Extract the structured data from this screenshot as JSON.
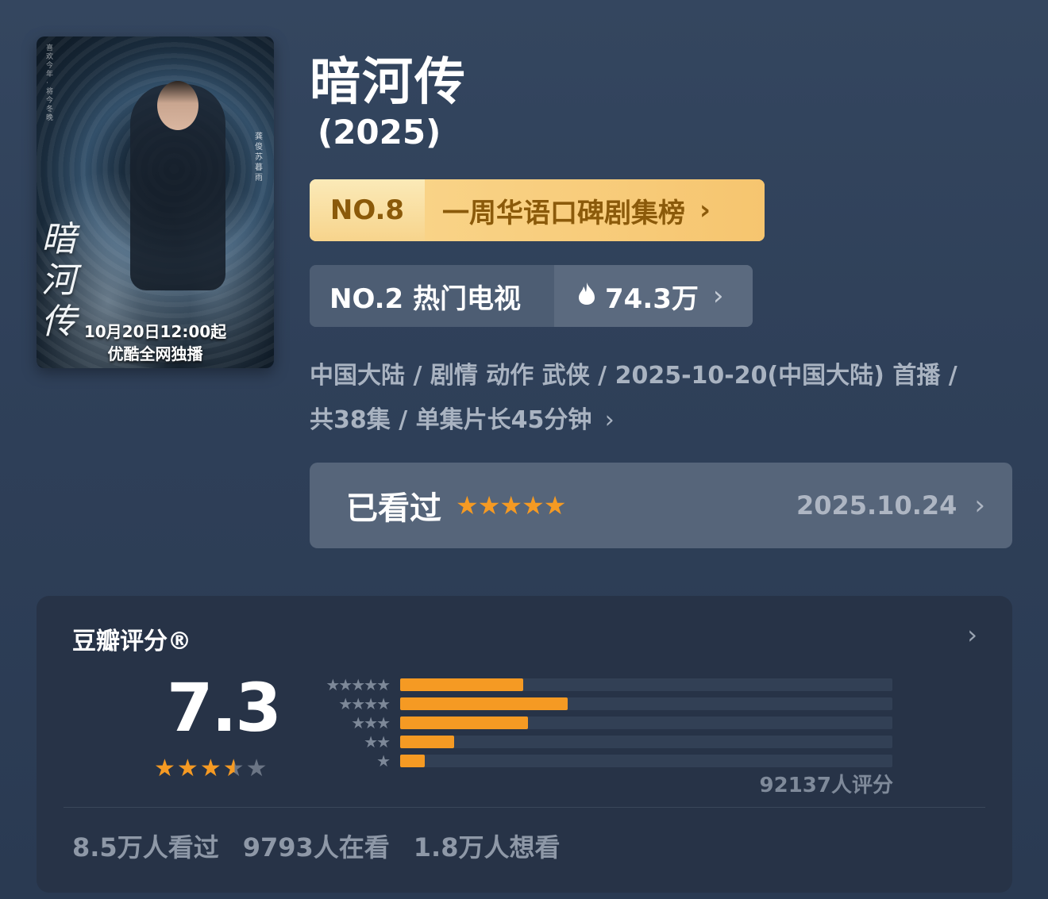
{
  "poster": {
    "calligraphy": "暗河传",
    "caption_line1": "10月20日12:00起",
    "caption_line2": "优酷全网独播",
    "side_text_left": "喜欢今年·将今冬晚",
    "side_text_right": "龚俊苏暮雨"
  },
  "title": "暗河传",
  "year": "(2025)",
  "rank_weekly": {
    "no": "NO.8",
    "label": "一周华语口碑剧集榜",
    "chevron": "›"
  },
  "rank_hot": {
    "label": "NO.2 热门电视",
    "flame_icon": "flame-icon",
    "heat": "74.3万",
    "chevron": "›"
  },
  "meta": {
    "line1": "中国大陆 / 剧情 动作 武侠 / 2025-10-20(中国大陆) 首播 /",
    "line2": "共38集 / 单集片长45分钟",
    "chevron": "›"
  },
  "watched": {
    "label": "已看过",
    "my_stars": 5,
    "stars_text": "★★★★★",
    "date": "2025.10.24",
    "chevron": "›"
  },
  "rating": {
    "title": "豆瓣评分®",
    "chevron": "›",
    "score": "7.3",
    "stars_value": 3.5,
    "distribution": [
      {
        "stars": "★★★★★",
        "fraction": 0.25
      },
      {
        "stars": "★★★★",
        "fraction": 0.34
      },
      {
        "stars": "★★★",
        "fraction": 0.26
      },
      {
        "stars": "★★",
        "fraction": 0.11
      },
      {
        "stars": "★",
        "fraction": 0.05
      }
    ],
    "count": "92137人评分",
    "stats": {
      "watched": "8.5万人看过",
      "watching": "9793人在看",
      "want": "1.8万人想看"
    }
  },
  "colors": {
    "accent": "#f59a23",
    "background": "#2f4059",
    "card": "#273347",
    "rank_gold_text": "#8b5a0a"
  }
}
